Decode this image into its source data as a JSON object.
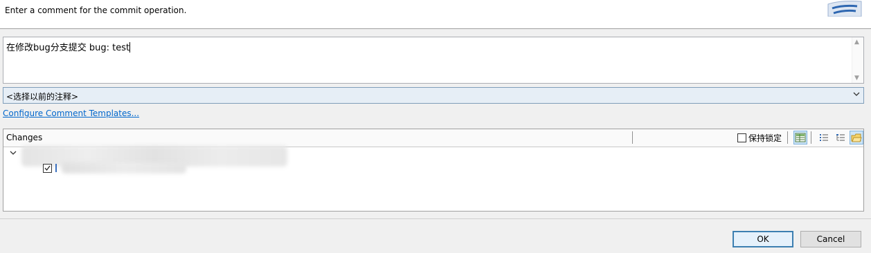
{
  "header": {
    "message": "Enter a comment for the commit operation."
  },
  "comment": {
    "value": "在修改bug分支提交 bug: test"
  },
  "previous_comments": {
    "selected": "<选择以前的注释>"
  },
  "configure_link": "Configure Comment Templates...",
  "changes": {
    "label": "Changes",
    "keep_locks_label": "保持锁定",
    "keep_locks_checked": false,
    "toolbar_icons": [
      "table-view-icon",
      "flat-list-icon",
      "tree-list-icon",
      "compressed-folders-icon"
    ]
  },
  "buttons": {
    "ok": "OK",
    "cancel": "Cancel"
  },
  "colors": {
    "link": "#0066cc",
    "combo_bg": "#e6eef6",
    "default_button_border": "#3c7fb1"
  }
}
